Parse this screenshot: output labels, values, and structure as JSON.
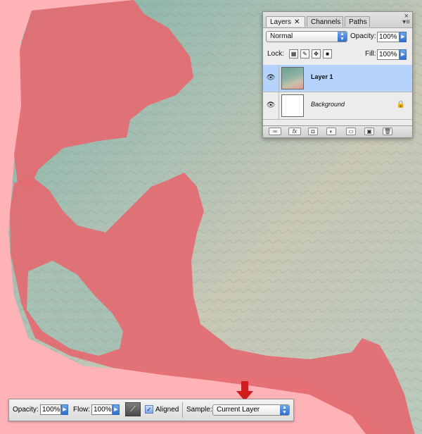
{
  "layers_panel": {
    "tabs": [
      {
        "label": "Layers",
        "close": "✕"
      },
      {
        "label": "Channels"
      },
      {
        "label": "Paths"
      }
    ],
    "blend_mode": "Normal",
    "opacity_label": "Opacity:",
    "opacity_value": "100%",
    "lock_label": "Lock:",
    "fill_label": "Fill:",
    "fill_value": "100%",
    "layers": [
      {
        "name": "Layer 1",
        "selected": true
      },
      {
        "name": "Background",
        "locked": true
      }
    ]
  },
  "options_bar": {
    "opacity_label": "Opacity:",
    "opacity_value": "100%",
    "flow_label": "Flow:",
    "flow_value": "100%",
    "aligned_label": "Aligned",
    "aligned_checked": true,
    "sample_label": "Sample:",
    "sample_value": "Current Layer"
  },
  "colors": {
    "mask_overlay": "#e36c72",
    "selection_blue": "#b5d3fb",
    "arrow_red": "#d11c1c"
  }
}
